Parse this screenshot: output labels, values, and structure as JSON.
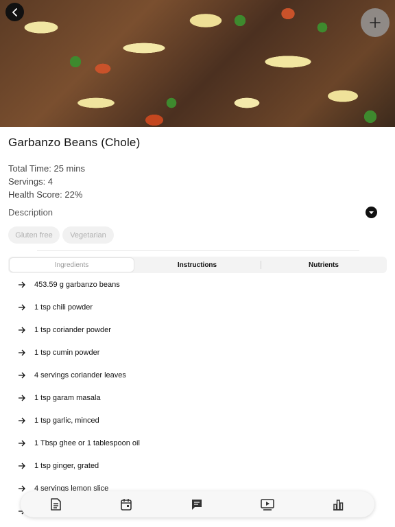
{
  "recipe": {
    "title": "Garbanzo Beans (Chole)",
    "total_time": "Total Time: 25 mins",
    "servings": "Servings: 4",
    "health_score": "Health Score: 22%",
    "description_label": "Description",
    "tags": [
      "Gluten free",
      "Vegetarian"
    ]
  },
  "tabs": [
    {
      "label": "Ingredients",
      "active": true
    },
    {
      "label": "Instructions",
      "active": false
    },
    {
      "label": "Nutrients",
      "active": false
    }
  ],
  "ingredients": [
    "453.59 g garbanzo beans",
    "1 tsp chili powder",
    "1 tsp coriander powder",
    "1 tsp cumin powder",
    "4 servings coriander leaves",
    "1 tsp garam masala",
    "1 tsp garlic, minced",
    "1 Tbsp ghee or 1 tablespoon oil",
    "1 tsp ginger, grated",
    "4 servings lemon slice"
  ],
  "icons": {
    "back": "chevron-left-icon",
    "add": "plus-icon",
    "description_toggle": "chevron-down-icon",
    "ingredient_bullet": "arrow-right-icon",
    "nav": [
      "document-icon",
      "calendar-icon",
      "chat-icon",
      "video-icon",
      "chart-icon"
    ]
  },
  "colors": {
    "accent": "#111111",
    "chip_bg": "#f1f1f1",
    "chip_text": "#b0b0b0"
  }
}
